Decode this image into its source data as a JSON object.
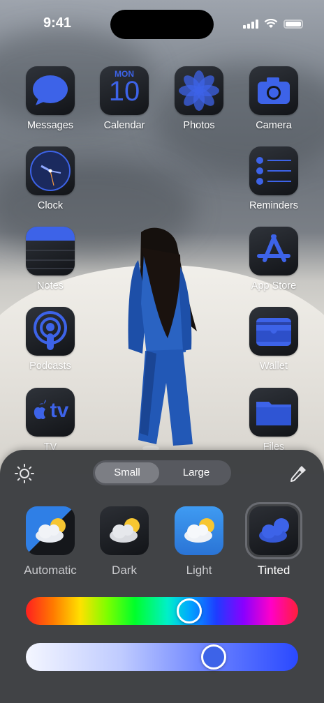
{
  "status_bar": {
    "time": "9:41"
  },
  "apps": [
    {
      "label": "Messages",
      "icon": "messages-icon"
    },
    {
      "label": "Calendar",
      "icon": "calendar-icon",
      "day": "MON",
      "date": "10"
    },
    {
      "label": "Photos",
      "icon": "photos-icon"
    },
    {
      "label": "Camera",
      "icon": "camera-icon"
    },
    {
      "label": "Clock",
      "icon": "clock-icon"
    },
    {
      "label": "Reminders",
      "icon": "reminders-icon"
    },
    {
      "label": "Notes",
      "icon": "notes-icon"
    },
    {
      "label": "App Store",
      "icon": "app-store-icon"
    },
    {
      "label": "Podcasts",
      "icon": "podcasts-icon"
    },
    {
      "label": "Wallet",
      "icon": "wallet-icon"
    },
    {
      "label": "TV",
      "icon": "tv-icon",
      "glyph": "tv"
    },
    {
      "label": "Files",
      "icon": "files-icon"
    }
  ],
  "panel": {
    "size_options": [
      "Small",
      "Large"
    ],
    "size_selected": "Small",
    "variants": [
      {
        "label": "Automatic",
        "icon": "weather-automatic-icon"
      },
      {
        "label": "Dark",
        "icon": "weather-dark-icon"
      },
      {
        "label": "Light",
        "icon": "weather-light-icon"
      },
      {
        "label": "Tinted",
        "icon": "weather-tinted-icon"
      }
    ],
    "variant_selected": "Tinted",
    "hue_level": 0.61,
    "saturation_level": 0.71
  },
  "colors": {
    "tint": "#3d63e8",
    "panel": "#3a3c40"
  }
}
